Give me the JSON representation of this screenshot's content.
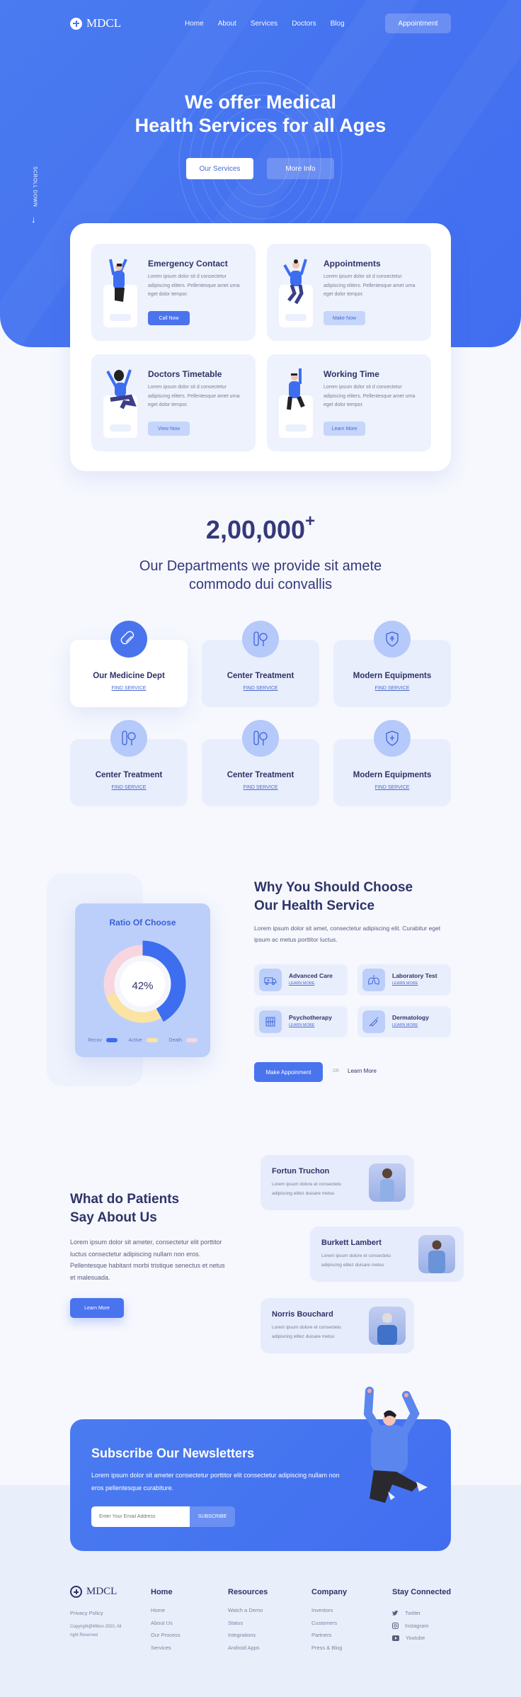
{
  "brand": {
    "name": "MDCL"
  },
  "nav": {
    "items": [
      "Home",
      "About",
      "Services",
      "Doctors",
      "Blog"
    ],
    "cta": "Appointment"
  },
  "hero": {
    "title_line1": "We offer Medical",
    "title_line2": "Health Services for all Ages",
    "primary_button": "Our Services",
    "secondary_button": "More Info",
    "scroll_label": "SCROLL DOWN"
  },
  "service_cards": [
    {
      "title": "Emergency Contact",
      "text": "Lorem ipsum dolor sit d consectetur adipiscing eliters. Pellentesque amet urna eget dolor tempor.",
      "button": "Call Now"
    },
    {
      "title": "Appointments",
      "text": "Lorem ipsum dolor sit d consectetur adipiscing eliters. Pellentesque amet urna eget dolor tempor.",
      "button": "Make Now"
    },
    {
      "title": "Doctors Timetable",
      "text": "Lorem ipsum dolor sit d consectetur adipiscing eliters. Pellentesque amet urna eget dolor tempor.",
      "button": "View Now"
    },
    {
      "title": "Working Time",
      "text": "Lorem ipsum dolor sit d consectetur adipiscing eliters. Pellentesque amet urna eget dolor tempor.",
      "button": "Learn More"
    }
  ],
  "stats": {
    "value": "2,00,000",
    "suffix": "+",
    "subtitle_line1": "Our Departments we provide sit amete",
    "subtitle_line2": "commodo dui convallis"
  },
  "departments": [
    {
      "title": "Our Medicine Dept",
      "link": "FIND SERVICE",
      "icon": "pill-icon"
    },
    {
      "title": "Center Treatment",
      "link": "FIND SERVICE",
      "icon": "test-tube-icon"
    },
    {
      "title": "Modern Equipments",
      "link": "FIND SERVICE",
      "icon": "shield-cross-icon"
    },
    {
      "title": "Center Treatment",
      "link": "FIND SERVICE",
      "icon": "test-tube-icon"
    },
    {
      "title": "Center Treatment",
      "link": "FIND SERVICE",
      "icon": "test-tube-icon"
    },
    {
      "title": "Modern Equipments",
      "link": "FIND SERVICE",
      "icon": "shield-cross-icon"
    }
  ],
  "ratio_card": {
    "title": "Ratio Of Choose",
    "center_label": "42%",
    "segments": [
      {
        "name": "Recov",
        "percent": 42,
        "color": "#3d6ef0"
      },
      {
        "name": "Active",
        "percent": 28,
        "color": "#fbe3a4"
      },
      {
        "name": "Death",
        "percent": 30,
        "color": "#f7d6df"
      }
    ]
  },
  "why": {
    "title_line1": "Why You Should Choose",
    "title_line2": "Our Health Service",
    "text": "Lorem ipsum dolor sit amet, consectetur adipiscing elit. Curabitur eget ipsum ac metus porttitor luctus.",
    "features": [
      {
        "title": "Advanced Care",
        "link": "LEARN MORE",
        "icon": "ambulance-icon"
      },
      {
        "title": "Laboratory Test",
        "link": "LEARN MORE",
        "icon": "lungs-icon"
      },
      {
        "title": "Psychotherapy",
        "link": "LEARN MORE",
        "icon": "brain-chart-icon"
      },
      {
        "title": "Dermatology",
        "link": "LEARN MORE",
        "icon": "syringe-icon"
      }
    ],
    "primary_button": "Make Appoinment",
    "or_label": "OR",
    "secondary_link": "Learn More"
  },
  "testimonials": {
    "title_line1": "What do Patients",
    "title_line2": "Say About Us",
    "text": "Lorem ipsum dolor sit ameter, consectetur elit porttitor luctus consectetur adipiscing nullam non eros. Pellentesque habitant morbi tristique senectus et netus et malesuada.",
    "button": "Learn More",
    "items": [
      {
        "name": "Fortun Truchon",
        "text": "Lorem ipsum dolore et consectetu adipiscing elitez duisare metus"
      },
      {
        "name": "Burkett Lambert",
        "text": "Lorem ipsum dolore et consectetu adipiscing elitez duisare metus"
      },
      {
        "name": "Norris Bouchard",
        "text": "Lorem ipsum dolore et consectetu adipiscing elitez duisare metus"
      }
    ]
  },
  "newsletter": {
    "title": "Subscribe Our Newsletters",
    "text": "Lorem ipsum dolor sit ameter consectetur porttitor elit consectetur adipiscing nullam  non eros pellentesque curabiture.",
    "placeholder": "Enter Your Email Address",
    "button": "SUBSCRIBE"
  },
  "footer": {
    "privacy": "Privacy Policy",
    "copyright": "Copyright@Milton 2020, All right Reserved",
    "columns": [
      {
        "title": "Home",
        "links": [
          "Home",
          "About Us",
          "Our Process",
          "Services"
        ]
      },
      {
        "title": "Resources",
        "links": [
          "Watch a Demo",
          "Status",
          "Integrations",
          "Android Apps"
        ]
      },
      {
        "title": "Company",
        "links": [
          "Investors",
          "Customers",
          "Partners",
          "Press & Blog"
        ]
      }
    ],
    "social": {
      "title": "Stay Connected",
      "links": [
        {
          "label": "Twitter",
          "icon": "twitter-icon"
        },
        {
          "label": "Instagram",
          "icon": "instagram-icon"
        },
        {
          "label": "Youtube",
          "icon": "youtube-icon"
        }
      ]
    }
  }
}
